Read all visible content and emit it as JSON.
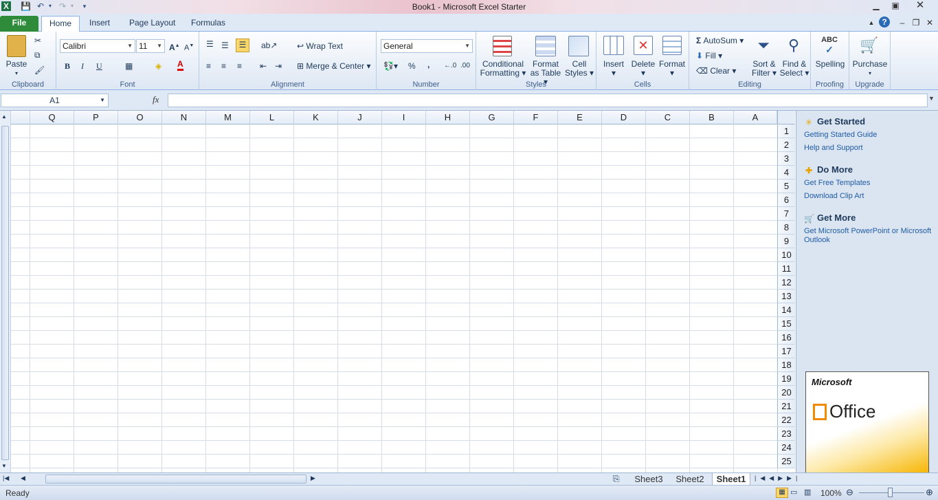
{
  "window": {
    "title": "Book1  -  Microsoft Excel Starter"
  },
  "tabs": [
    {
      "label": "File"
    },
    {
      "label": "Home"
    },
    {
      "label": "Insert"
    },
    {
      "label": "Page Layout"
    },
    {
      "label": "Formulas"
    }
  ],
  "ribbon": {
    "clipboard": {
      "label": "Clipboard",
      "paste": "Paste"
    },
    "font": {
      "label": "Font",
      "family": "Calibri",
      "size": "11",
      "bold": "B",
      "italic": "I",
      "underline": "U"
    },
    "alignment": {
      "label": "Alignment",
      "wrap": "Wrap Text",
      "merge": "Merge & Center"
    },
    "number": {
      "label": "Number",
      "format": "General",
      "percent": "%",
      "comma": ","
    },
    "styles": {
      "label": "Styles",
      "conditional": [
        "Conditional",
        "Formatting"
      ],
      "format_table": [
        "Format",
        "as Table"
      ],
      "cell_styles": [
        "Cell",
        "Styles"
      ]
    },
    "cells": {
      "label": "Cells",
      "insert": "Insert",
      "delete": "Delete",
      "format": "Format"
    },
    "editing": {
      "label": "Editing",
      "autosum": "AutoSum",
      "fill": "Fill",
      "clear": "Clear",
      "sort": [
        "Sort &",
        "Filter"
      ],
      "find": [
        "Find &",
        "Select"
      ]
    },
    "proofing": {
      "label": "Proofing",
      "spelling": "Spelling",
      "abc": "ABC"
    },
    "upgrade": {
      "label": "Upgrade",
      "purchase": "Purchase"
    }
  },
  "formula_bar": {
    "name_box": "A1",
    "fx": "fx",
    "value": ""
  },
  "grid": {
    "columns": [
      "Q",
      "P",
      "O",
      "N",
      "M",
      "L",
      "K",
      "J",
      "I",
      "H",
      "G",
      "F",
      "E",
      "D",
      "C",
      "B",
      "A"
    ],
    "rows": [
      "1",
      "2",
      "3",
      "4",
      "5",
      "6",
      "7",
      "8",
      "9",
      "10",
      "11",
      "12",
      "13",
      "14",
      "15",
      "16",
      "17",
      "18",
      "19",
      "20",
      "21",
      "22",
      "23",
      "24",
      "25"
    ]
  },
  "side_pane": {
    "get_started": {
      "heading": "Get Started",
      "links": [
        "Getting Started Guide",
        "Help and Support"
      ]
    },
    "do_more": {
      "heading": "Do More",
      "links": [
        "Get Free Templates",
        "Download Clip Art"
      ]
    },
    "get_more": {
      "heading": "Get More",
      "links": [
        "Get Microsoft PowerPoint or Microsoft",
        "Outlook"
      ]
    },
    "ad": {
      "brand": "Microsoft",
      "product": "Office"
    }
  },
  "sheets": [
    "Sheet3",
    "Sheet2",
    "Sheet1"
  ],
  "status": {
    "mode": "Ready",
    "zoom": "100%"
  }
}
